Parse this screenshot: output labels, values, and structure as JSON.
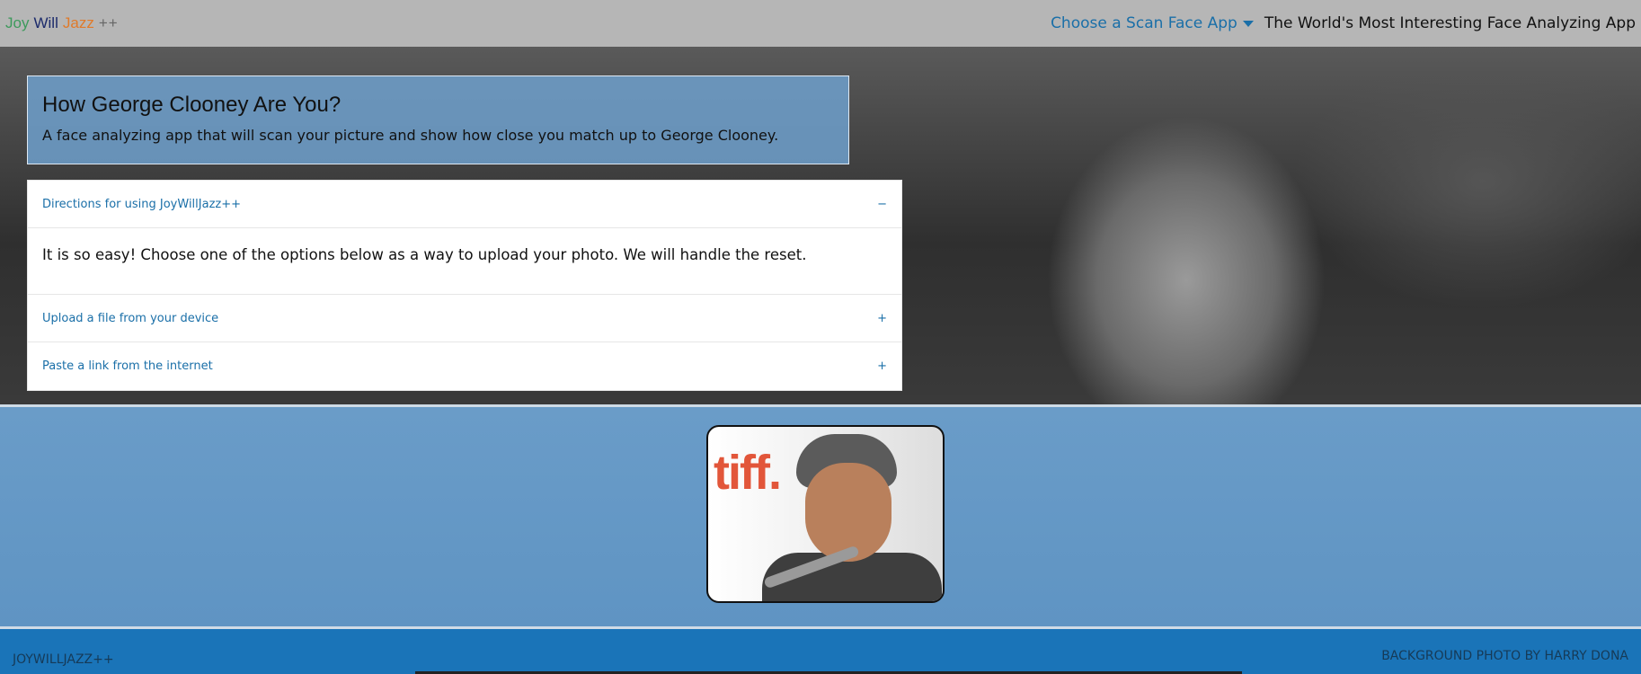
{
  "brand": {
    "word1": "Joy",
    "word2": "Will",
    "word3": "Jazz",
    "word4": "++"
  },
  "nav": {
    "dropdown_label": "Choose a Scan Face App",
    "tagline": "The World's Most Interesting Face Analyzing App"
  },
  "hero": {
    "title": "How George Clooney Are You?",
    "subtitle": "A face analyzing app that will scan your picture and show how close you match up to George Clooney."
  },
  "accordion": {
    "items": [
      {
        "title": "Directions for using JoyWillJazz++",
        "sign": "−",
        "body": "It is so easy! Choose one of the options below as a way to upload your photo. We will handle the reset."
      },
      {
        "title": "Upload a file from your device",
        "sign": "+"
      },
      {
        "title": "Paste a link from the internet",
        "sign": "+"
      }
    ]
  },
  "photo": {
    "overlay_text": "tiff."
  },
  "footer": {
    "left": "JOYWILLJAZZ++",
    "right": "BACKGROUND PHOTO BY HARRY DONA"
  },
  "colors": {
    "accent": "#1a6fa8",
    "band": "#6a9cc8",
    "footer": "#1a74b8"
  },
  "icons": {
    "dropdown": "caret-down-icon"
  }
}
